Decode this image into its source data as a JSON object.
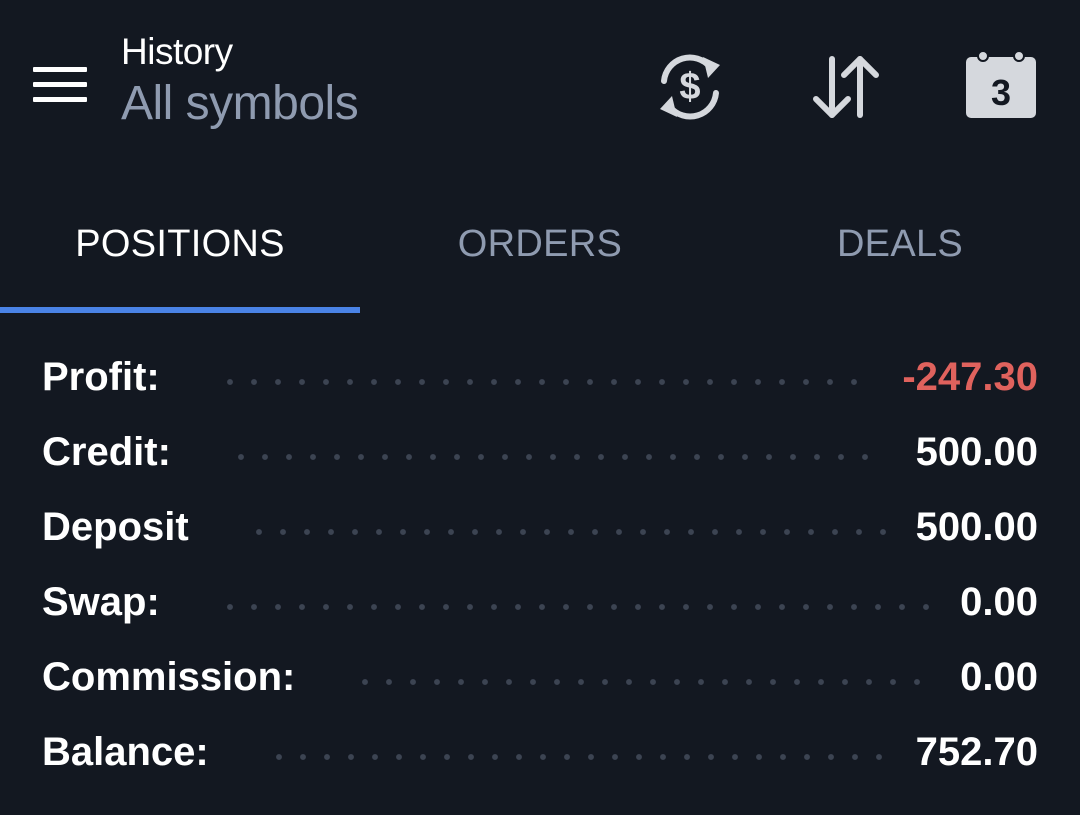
{
  "header": {
    "title": "History",
    "subtitle": "All symbols",
    "icons": {
      "menu": "hamburger-menu-icon",
      "currency": "currency-exchange-icon",
      "sort": "sort-icon",
      "calendar": "calendar-icon"
    },
    "calendar_day": "3"
  },
  "tabs": [
    {
      "label": "POSITIONS",
      "active": true
    },
    {
      "label": "ORDERS",
      "active": false
    },
    {
      "label": "DEALS",
      "active": false
    }
  ],
  "summary": [
    {
      "label": "Profit:",
      "value": "-247.30"
    },
    {
      "label": "Credit:",
      "value": "500.00"
    },
    {
      "label": "Deposit",
      "value": "500.00"
    },
    {
      "label": "Swap:",
      "value": "0.00"
    },
    {
      "label": "Commission:",
      "value": "0.00"
    },
    {
      "label": "Balance:",
      "value": "752.70"
    }
  ],
  "colors": {
    "background": "#131821",
    "accent": "#4a83e6",
    "negative": "#e0625d",
    "muted": "#8f9bb0"
  }
}
